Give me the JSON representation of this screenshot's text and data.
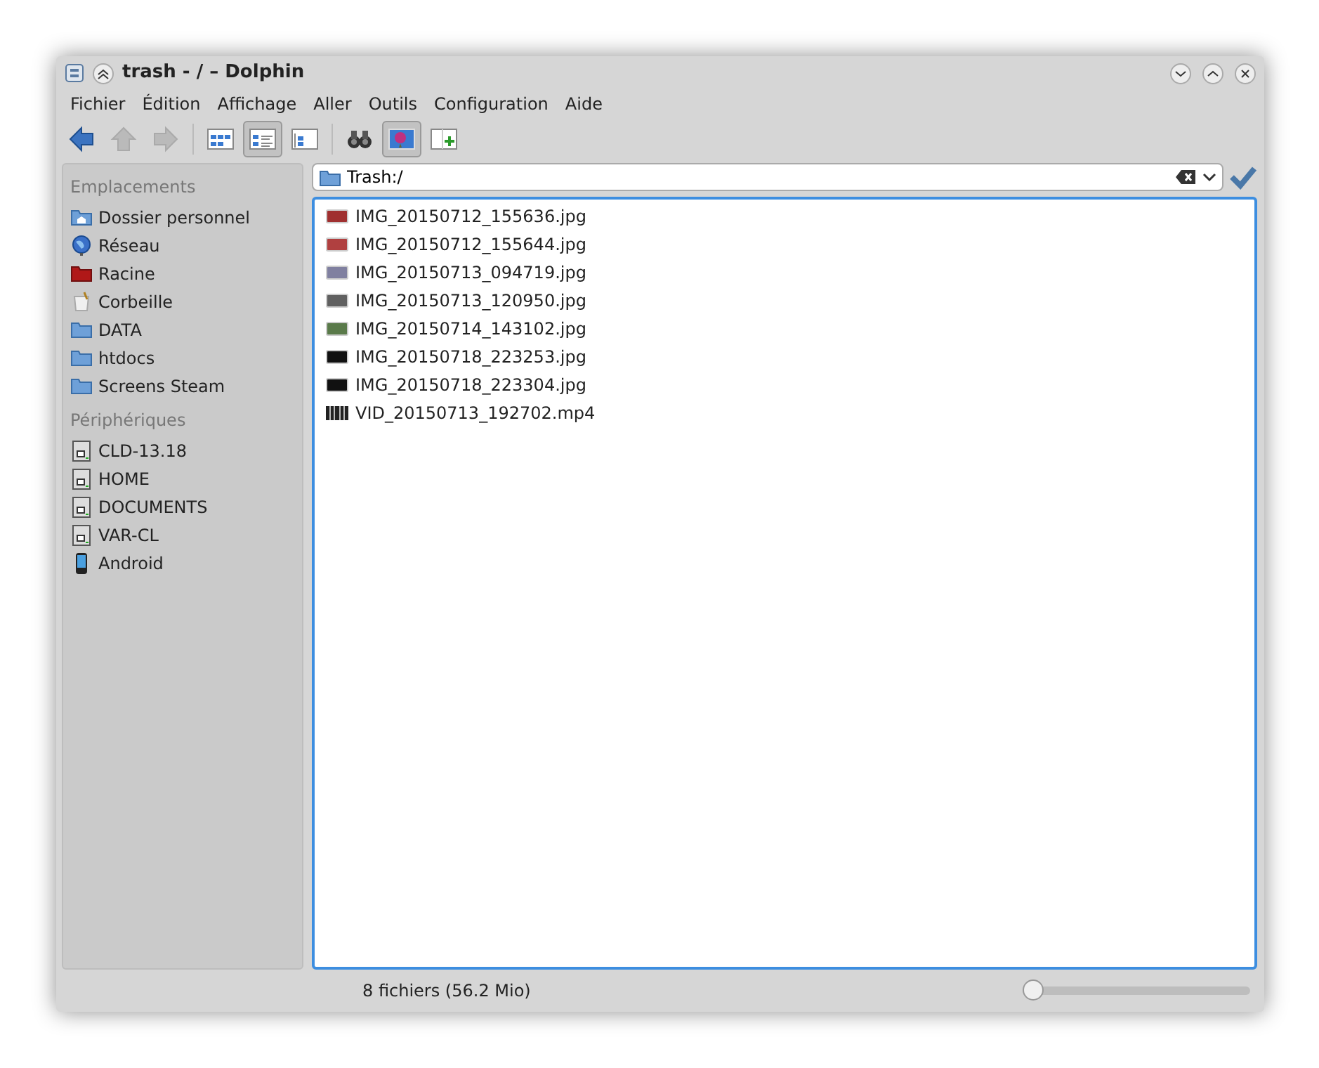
{
  "window": {
    "title": "trash - / – Dolphin"
  },
  "menu": [
    "Fichier",
    "Édition",
    "Affichage",
    "Aller",
    "Outils",
    "Configuration",
    "Aide"
  ],
  "toolbar": [
    {
      "kind": "back",
      "disabled": false,
      "selected": false
    },
    {
      "kind": "up",
      "disabled": true,
      "selected": false
    },
    {
      "kind": "forward",
      "disabled": true,
      "selected": false
    },
    {
      "kind": "sep"
    },
    {
      "kind": "icons-view",
      "disabled": false,
      "selected": false
    },
    {
      "kind": "details-view",
      "disabled": false,
      "selected": true
    },
    {
      "kind": "columns-view",
      "disabled": false,
      "selected": false
    },
    {
      "kind": "sep"
    },
    {
      "kind": "find",
      "disabled": false,
      "selected": false
    },
    {
      "kind": "preview",
      "disabled": false,
      "selected": true
    },
    {
      "kind": "split",
      "disabled": false,
      "selected": false
    }
  ],
  "sidebar": [
    {
      "heading": "Emplacements",
      "items": [
        {
          "label": "Dossier personnel",
          "kind": "home"
        },
        {
          "label": "Réseau",
          "kind": "network"
        },
        {
          "label": "Racine",
          "kind": "root"
        },
        {
          "label": "Corbeille",
          "kind": "trash"
        },
        {
          "label": "DATA",
          "kind": "folder"
        },
        {
          "label": "htdocs",
          "kind": "folder"
        },
        {
          "label": "Screens Steam",
          "kind": "folder"
        }
      ]
    },
    {
      "heading": "Périphériques",
      "items": [
        {
          "label": "CLD-13.18",
          "kind": "drive"
        },
        {
          "label": "HOME",
          "kind": "drive"
        },
        {
          "label": "DOCUMENTS",
          "kind": "drive"
        },
        {
          "label": "VAR-CL",
          "kind": "drive"
        },
        {
          "label": "Android",
          "kind": "phone"
        }
      ]
    }
  ],
  "location": "Trash:/",
  "files": [
    {
      "name": "IMG_20150712_155636.jpg",
      "kind": "image",
      "color": "#a03030"
    },
    {
      "name": "IMG_20150712_155644.jpg",
      "kind": "image",
      "color": "#b04040"
    },
    {
      "name": "IMG_20150713_094719.jpg",
      "kind": "image",
      "color": "#8080a0"
    },
    {
      "name": "IMG_20150713_120950.jpg",
      "kind": "image",
      "color": "#606060"
    },
    {
      "name": "IMG_20150714_143102.jpg",
      "kind": "image",
      "color": "#5a7a4a"
    },
    {
      "name": "IMG_20150718_223253.jpg",
      "kind": "image",
      "color": "#111111"
    },
    {
      "name": "IMG_20150718_223304.jpg",
      "kind": "image",
      "color": "#111111"
    },
    {
      "name": "VID_20150713_192702.mp4",
      "kind": "video",
      "color": "#222222"
    }
  ],
  "status": "8 fichiers (56.2 Mio)",
  "zoom": {
    "level": 0
  }
}
